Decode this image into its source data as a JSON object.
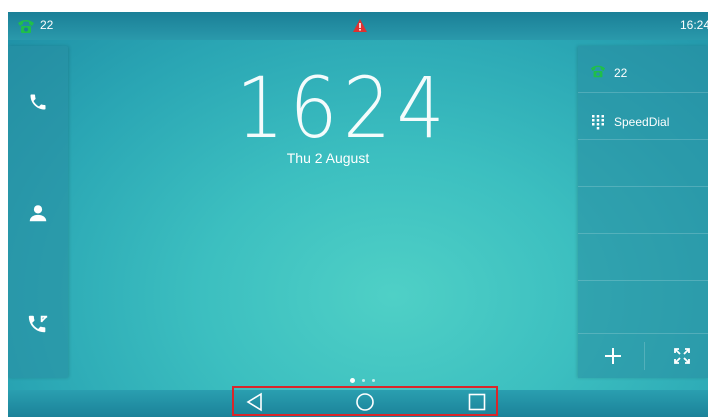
{
  "status_bar": {
    "line_icon": "phone-handset-icon",
    "line_number": "22",
    "warning_icon": "warning-triangle-icon",
    "time": "16:24"
  },
  "left_panel": {
    "items": [
      {
        "icon": "phone-icon"
      },
      {
        "icon": "contact-icon"
      },
      {
        "icon": "call-history-icon"
      }
    ]
  },
  "clock": {
    "time": "1624",
    "date": "Thu 2 August"
  },
  "right_panel": {
    "line": {
      "icon": "phone-handset-icon",
      "label": "22"
    },
    "speed_dial": {
      "icon": "keypad-icon",
      "label": "SpeedDial"
    },
    "add_icon": "plus-icon",
    "expand_icon": "expand-icon"
  },
  "page_indicator": {
    "count": 3,
    "active_index": 0
  },
  "nav_bar": {
    "back_icon": "back-triangle-icon",
    "home_icon": "home-circle-icon",
    "recents_icon": "recents-square-icon"
  },
  "colors": {
    "line_icon_green": "#1fbf4a",
    "warning_red": "#e03030",
    "highlight_red": "#d9262a"
  }
}
